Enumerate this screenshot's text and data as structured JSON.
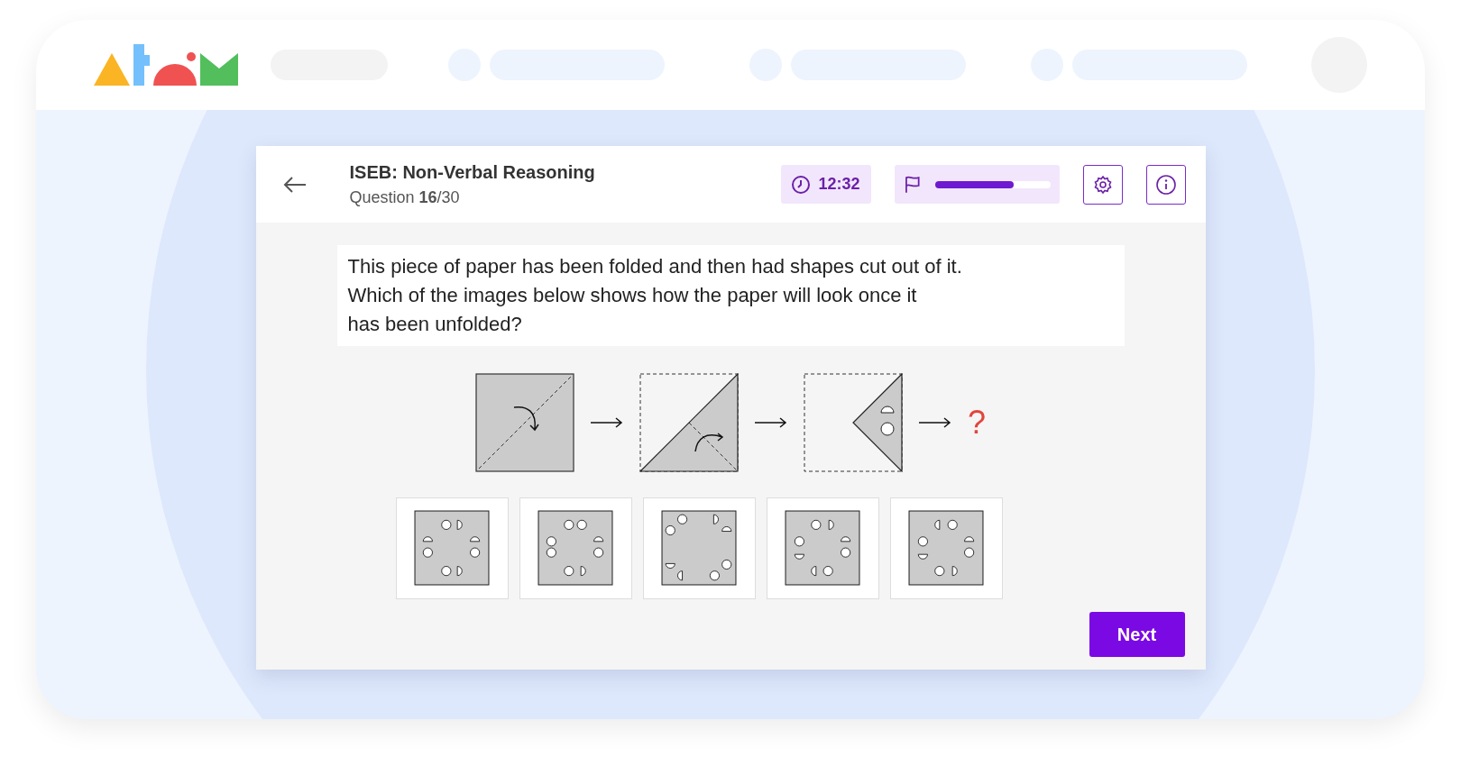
{
  "header": {
    "title": "ISEB: Non-Verbal Reasoning",
    "subtitle": "Question **16**/30"
  },
  "timer": {
    "time": "12:32"
  },
  "progress": {
    "level": 0.68
  },
  "question": {
    "lines": [
      "This piece of paper has been folded and then had shapes cut out of it.",
      "Which of the images below shows how the paper will look once it",
      "has been unfolded?"
    ]
  },
  "unknown_mark": "?",
  "next_button": "Next"
}
